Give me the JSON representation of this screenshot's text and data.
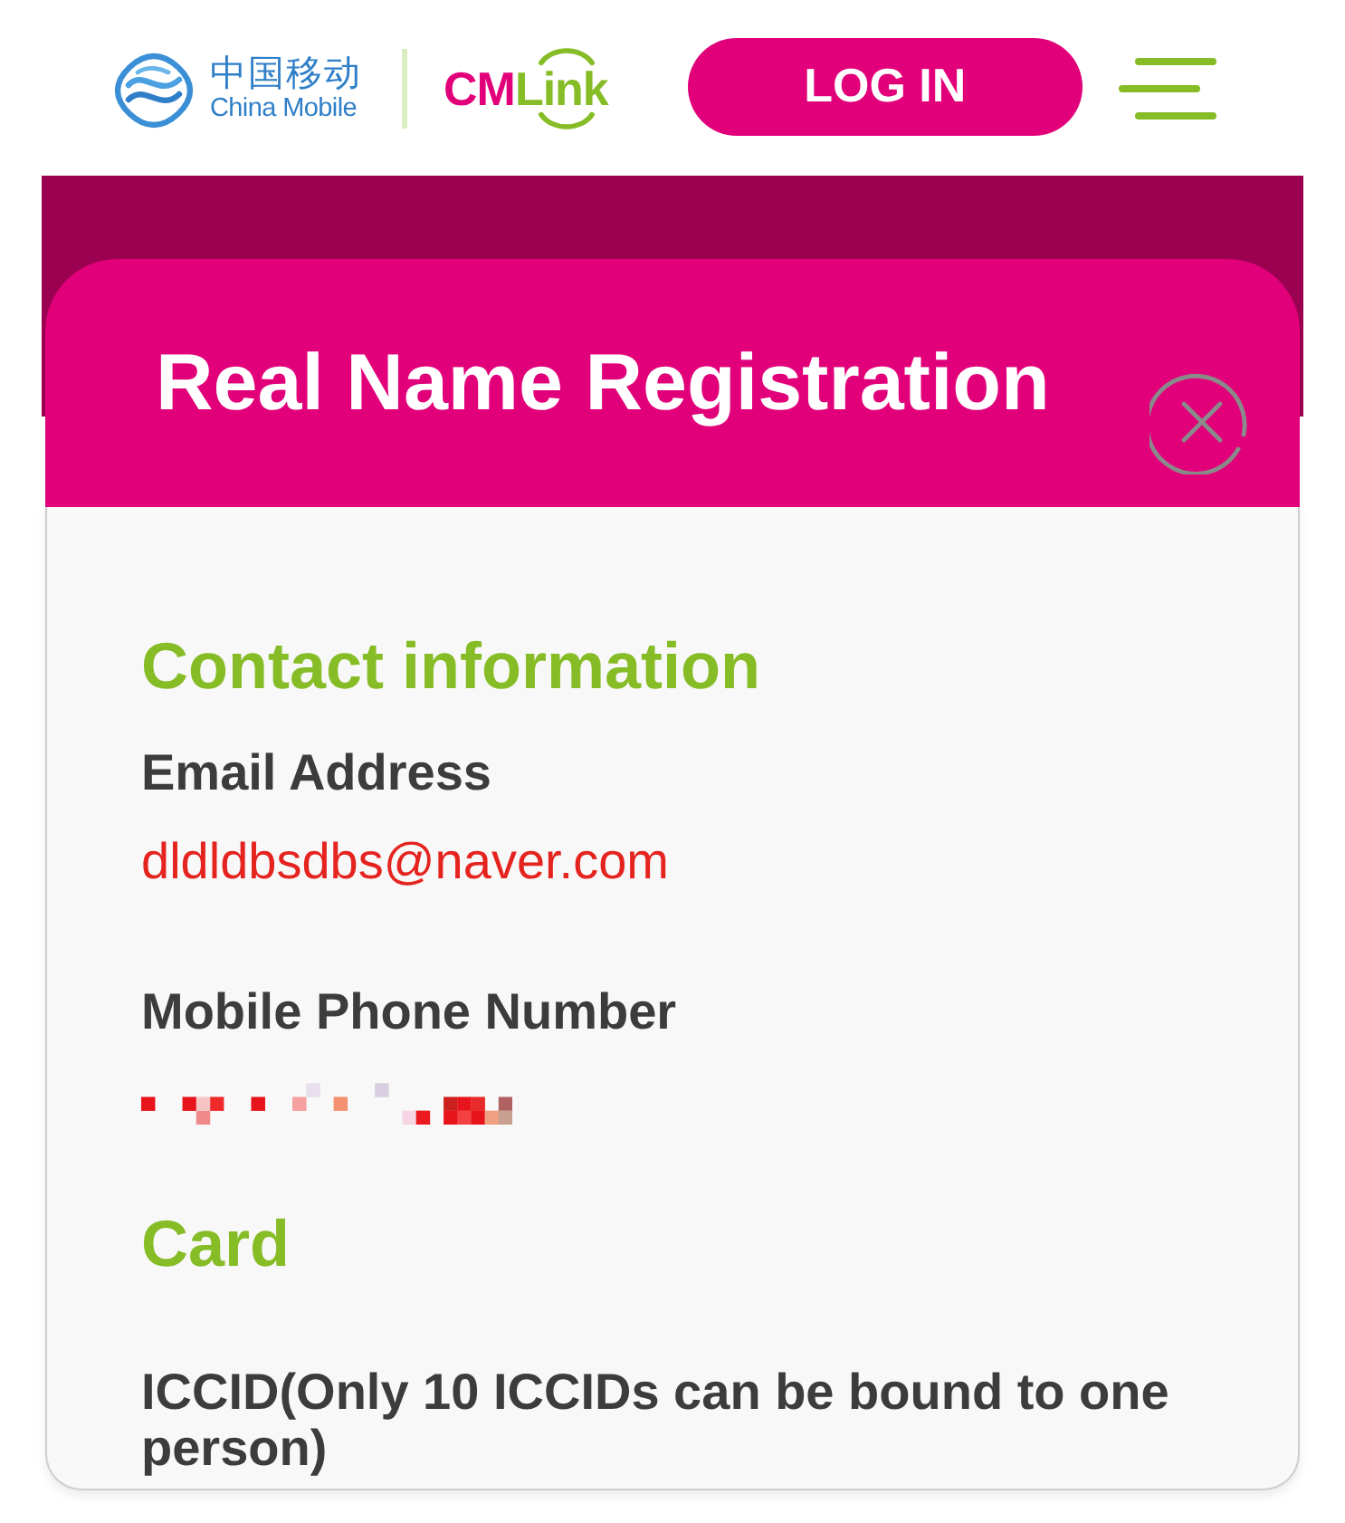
{
  "header": {
    "brand": {
      "chinese_name": "中国移动",
      "english_name": "China Mobile",
      "product_name_parts": [
        "CM",
        "Link"
      ]
    },
    "login_button": "LOG IN"
  },
  "modal": {
    "title": "Real Name Registration",
    "sections": [
      {
        "heading": "Contact information",
        "fields": [
          {
            "kind": "text",
            "label": "Email Address",
            "value": "dldldbsdbs@naver.com"
          },
          {
            "kind": "redacted",
            "label": "Mobile Phone Number"
          }
        ]
      },
      {
        "heading": "Card",
        "fields": [
          {
            "kind": "label",
            "label": "ICCID(Only 10 ICCIDs can be bound to one person)"
          }
        ]
      }
    ]
  }
}
